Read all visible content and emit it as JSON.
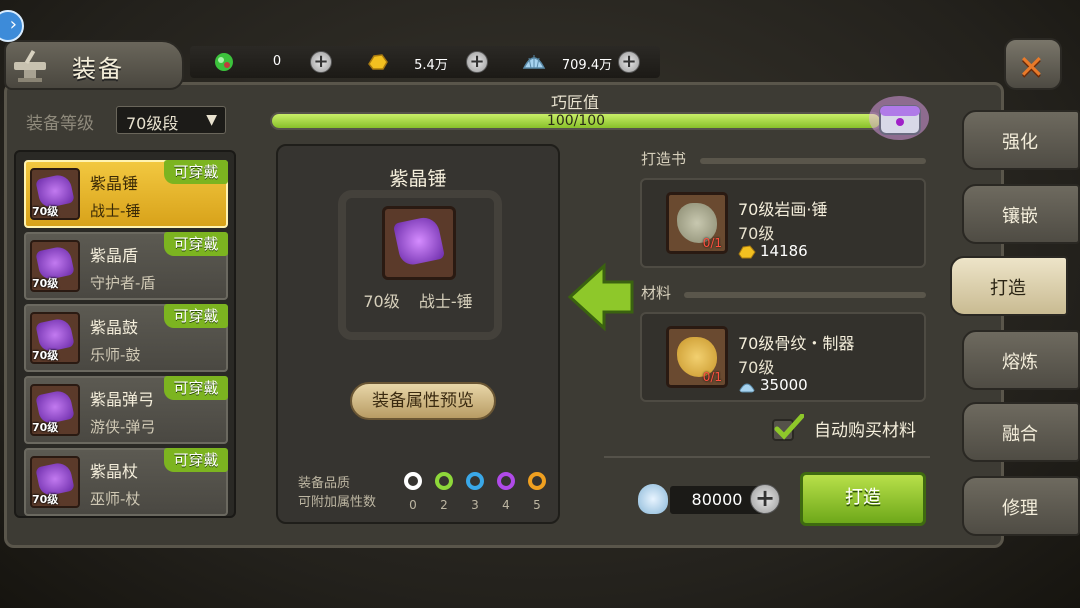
{
  "header": {
    "title": "装备",
    "toggle_icon": "chevron-right-icon"
  },
  "currency": [
    {
      "icon": "green-crystal-icon",
      "value": "0",
      "color": "#3cc23c"
    },
    {
      "icon": "gold-nugget-icon",
      "value": "5.4万",
      "color": "#f2c020"
    },
    {
      "icon": "shell-icon",
      "value": "709.4万",
      "color": "#a8d4f0"
    }
  ],
  "filter": {
    "label": "装备等级",
    "selected": "70级段"
  },
  "items": [
    {
      "name": "紫晶锤",
      "type": "战士-锤",
      "level": "70级",
      "badge": "可穿戴",
      "selected": true
    },
    {
      "name": "紫晶盾",
      "type": "守护者-盾",
      "level": "70级",
      "badge": "可穿戴",
      "selected": false
    },
    {
      "name": "紫晶鼓",
      "type": "乐师-鼓",
      "level": "70级",
      "badge": "可穿戴",
      "selected": false
    },
    {
      "name": "紫晶弹弓",
      "type": "游侠-弹弓",
      "level": "70级",
      "badge": "可穿戴",
      "selected": false
    },
    {
      "name": "紫晶杖",
      "type": "巫师-杖",
      "level": "70级",
      "badge": "可穿戴",
      "selected": false
    }
  ],
  "craft": {
    "title": "紫晶锤",
    "level": "70级",
    "type": "战士-锤",
    "preview_button": "装备属性预览",
    "quality_label_1": "装备品质",
    "quality_label_2": "可附加属性数",
    "quality_levels": [
      {
        "n": "0",
        "color": "#ffffff"
      },
      {
        "n": "2",
        "color": "#8ed83a"
      },
      {
        "n": "3",
        "color": "#3aa8e8"
      },
      {
        "n": "4",
        "color": "#b04ae8"
      },
      {
        "n": "5",
        "color": "#f0a020"
      }
    ]
  },
  "progress": {
    "label": "巧匠值",
    "text": "100/100",
    "fraction": 1.0
  },
  "book": {
    "section": "打造书",
    "name": "70级岩画·锤",
    "level": "70级",
    "count": "0/1",
    "cost": "14186",
    "cost_icon": "gold-nugget-icon"
  },
  "material": {
    "section": "材料",
    "name": "70级骨纹・制器",
    "level": "70级",
    "count": "0/1",
    "cost": "35000",
    "cost_icon": "shell-icon"
  },
  "auto_buy": {
    "label": "自动购买材料",
    "checked": true
  },
  "total_cost": {
    "value": "80000",
    "icon": "shell-icon"
  },
  "craft_button": "打造",
  "tabs": [
    {
      "label": "强化",
      "active": false
    },
    {
      "label": "镶嵌",
      "active": false
    },
    {
      "label": "打造",
      "active": true
    },
    {
      "label": "熔炼",
      "active": false
    },
    {
      "label": "融合",
      "active": false
    },
    {
      "label": "修理",
      "active": false
    }
  ]
}
